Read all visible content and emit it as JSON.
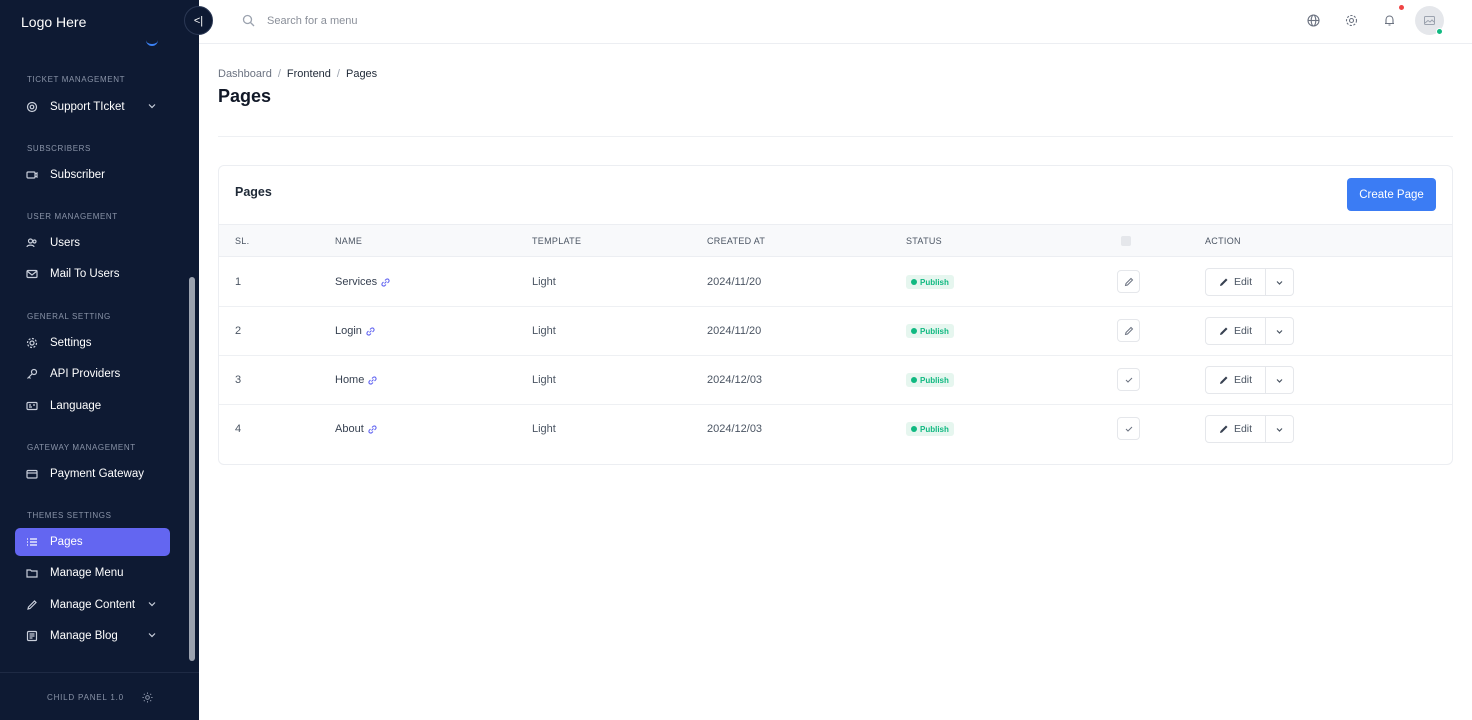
{
  "app": {
    "logo": "Logo Here",
    "footer_version": "CHILD PANEL 1.0"
  },
  "search": {
    "placeholder": "Search for a menu"
  },
  "sidebar": {
    "sections": [
      {
        "label": "TICKET MANAGEMENT"
      },
      {
        "label": "SUBSCRIBERS"
      },
      {
        "label": "USER MANAGEMENT"
      },
      {
        "label": "GENERAL SETTING"
      },
      {
        "label": "GATEWAY MANAGEMENT"
      },
      {
        "label": "THEMES SETTINGS"
      }
    ],
    "items": [
      {
        "label": "Support TIcket",
        "icon": "support-icon"
      },
      {
        "label": "Subscriber",
        "icon": "subscriber-icon"
      },
      {
        "label": "Users",
        "icon": "users-icon"
      },
      {
        "label": "Mail To Users",
        "icon": "mail-icon"
      },
      {
        "label": "Settings",
        "icon": "gear-icon"
      },
      {
        "label": "API Providers",
        "icon": "key-icon"
      },
      {
        "label": "Language",
        "icon": "language-icon"
      },
      {
        "label": "Payment Gateway",
        "icon": "wallet-icon"
      },
      {
        "label": "Pages",
        "icon": "list-icon",
        "active": true
      },
      {
        "label": "Manage Menu",
        "icon": "folder-icon"
      },
      {
        "label": "Manage Content",
        "icon": "pencil-icon"
      },
      {
        "label": "Manage Blog",
        "icon": "blog-icon"
      }
    ]
  },
  "breadcrumb": {
    "items": [
      "Dashboard",
      "Frontend",
      "Pages"
    ]
  },
  "page": {
    "title": "Pages"
  },
  "card": {
    "title": "Pages",
    "create_label": "Create Page"
  },
  "table": {
    "columns": [
      "SL.",
      "NAME",
      "TEMPLATE",
      "CREATED AT",
      "STATUS",
      "ACTION"
    ],
    "rows": [
      {
        "sl": "1",
        "name": "Services",
        "template": "Light",
        "created": "2024/11/20",
        "status": "Publish",
        "toggle": "pencil-icon",
        "edit": "Edit"
      },
      {
        "sl": "2",
        "name": "Login",
        "template": "Light",
        "created": "2024/11/20",
        "status": "Publish",
        "toggle": "pencil-icon",
        "edit": "Edit"
      },
      {
        "sl": "3",
        "name": "Home",
        "template": "Light",
        "created": "2024/12/03",
        "status": "Publish",
        "toggle": "check-icon",
        "edit": "Edit"
      },
      {
        "sl": "4",
        "name": "About",
        "template": "Light",
        "created": "2024/12/03",
        "status": "Publish",
        "toggle": "check-icon",
        "edit": "Edit"
      }
    ]
  },
  "colors": {
    "sidebar_bg": "#0e1a33",
    "active_item": "#6366f1",
    "primary_button": "#3b7cf4",
    "status_green": "#10b981"
  }
}
